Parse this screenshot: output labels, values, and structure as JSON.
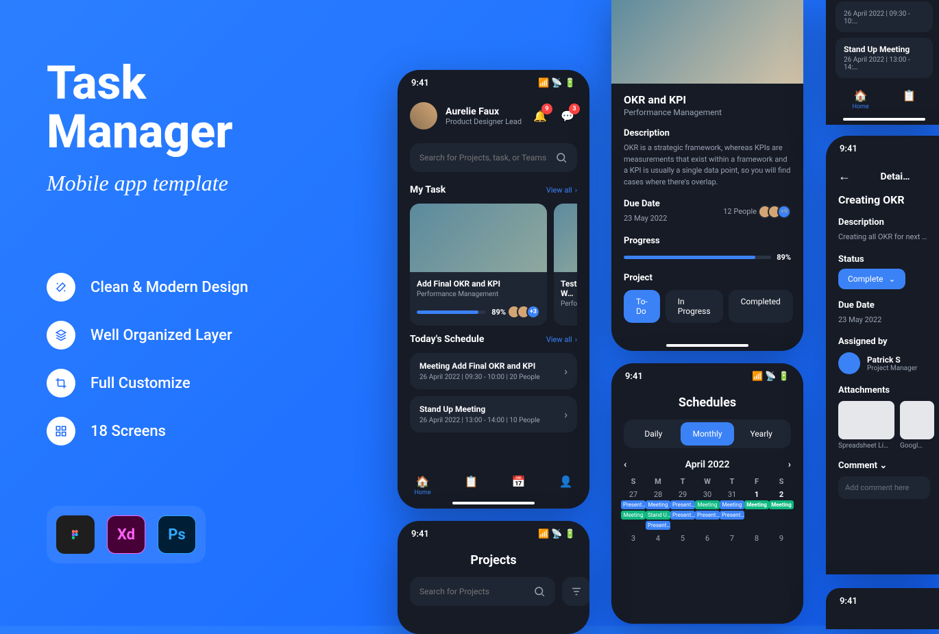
{
  "hero": {
    "title1": "Task",
    "title2": "Manager",
    "subtitle": "Mobile app template"
  },
  "features": [
    "Clean & Modern Design",
    "Well Organized Layer",
    "Full Customize",
    "18 Screens"
  ],
  "tools": [
    "Fg",
    "Xd",
    "Ps"
  ],
  "time": "9:41",
  "user": {
    "name": "Aurelie Faux",
    "role": "Product Designer Lead"
  },
  "badges": {
    "bell": "9",
    "chat": "3"
  },
  "search": {
    "placeholder": "Search for Projects, task, or Teams"
  },
  "mytask": {
    "title": "My Task",
    "viewall": "View all",
    "cards": [
      {
        "title": "Add Final OKR and KPI",
        "sub": "Performance Management",
        "pct": "89%",
        "more": "+3"
      },
      {
        "title": "Testing W…",
        "sub": "Performa…"
      }
    ]
  },
  "today": {
    "title": "Today's Schedule",
    "viewall": "View all",
    "items": [
      {
        "title": "Meeting Add Final OKR and KPI",
        "meta": "26 April 2022  |  09:30 - 10:00  |  20 People"
      },
      {
        "title": "Stand Up Meeting",
        "meta": "26 April 2022  |  13:00 - 14:00  |  10 People"
      }
    ]
  },
  "nav": {
    "home": "Home"
  },
  "detail": {
    "title": "OKR and KPI",
    "sub": "Performance Management",
    "desc_label": "Description",
    "desc": "OKR is a strategic framework, whereas KPIs are measurements that exist within a framework and a KPI is usually a single data point, so you will find cases where there's overlap.",
    "due_label": "Due Date",
    "due": "23 May 2022",
    "people": "12 People",
    "more": "+9",
    "progress_label": "Progress",
    "pct": "89%",
    "project_label": "Project",
    "tabs": [
      "To-Do",
      "In Progress",
      "Completed"
    ]
  },
  "sched": {
    "title": "Schedules",
    "seg": [
      "Daily",
      "Monthly",
      "Yearly"
    ],
    "month": "April 2022",
    "days": [
      "S",
      "M",
      "T",
      "W",
      "T",
      "F",
      "S"
    ],
    "w1": [
      "27",
      "28",
      "29",
      "30",
      "31",
      "1",
      "2"
    ],
    "w2": [
      "3",
      "4",
      "5",
      "6",
      "7",
      "8",
      "9"
    ]
  },
  "events": {
    "present": "Present…",
    "meeting": "Meeting",
    "standup": "Stand U…"
  },
  "mini": {
    "items": [
      {
        "meta": "26 April 2022  |  09:30 - 10:…"
      },
      {
        "title": "Stand Up Meeting",
        "meta": "26 April 2022  |  13:00 - 14:…"
      }
    ],
    "home": "Home"
  },
  "dt": {
    "header": "Detai…",
    "title": "Creating OKR",
    "desc_label": "Description",
    "desc": "Creating all OKR for next …",
    "status_label": "Status",
    "status": "Complete",
    "due_label": "Due Date",
    "due": "23 May 2022",
    "assigned_label": "Assigned by",
    "name": "Patrick S",
    "role": "Project Manager",
    "attach_label": "Attachments",
    "att1": "Spreadsheet Li…",
    "att2": "Googl…",
    "comment_label": "Comment",
    "comment_ph": "Add comment here"
  },
  "projects": {
    "title": "Projects",
    "search": "Search for Projects"
  }
}
